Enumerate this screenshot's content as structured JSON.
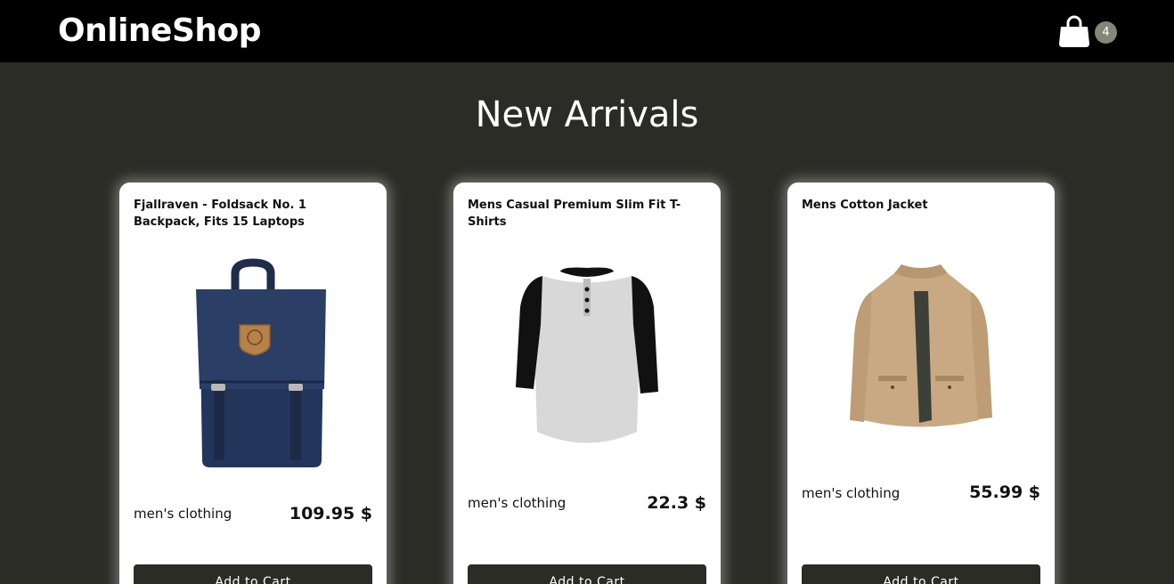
{
  "header": {
    "brand": "OnlineShop",
    "cart_icon": "shopping-bag-icon",
    "cart_count": "4"
  },
  "main": {
    "title": "New Arrivals",
    "products": [
      {
        "title": "Fjallraven - Foldsack No. 1 Backpack, Fits 15 Laptops",
        "category": "men's clothing",
        "price": "109.95 $",
        "image": "navy-backpack",
        "button": "Add to Cart"
      },
      {
        "title": "Mens Casual Premium Slim Fit T-Shirts",
        "category": "men's clothing",
        "price": "22.3 $",
        "image": "raglan-henley-shirt",
        "button": "Add to Cart"
      },
      {
        "title": "Mens Cotton Jacket",
        "category": "men's clothing",
        "price": "55.99 $",
        "image": "khaki-cotton-jacket",
        "button": "Add to Cart"
      }
    ]
  },
  "colors": {
    "topbar": "#000000",
    "background": "#2c2c27",
    "badge": "#85857a",
    "button": "#2c2c27"
  }
}
